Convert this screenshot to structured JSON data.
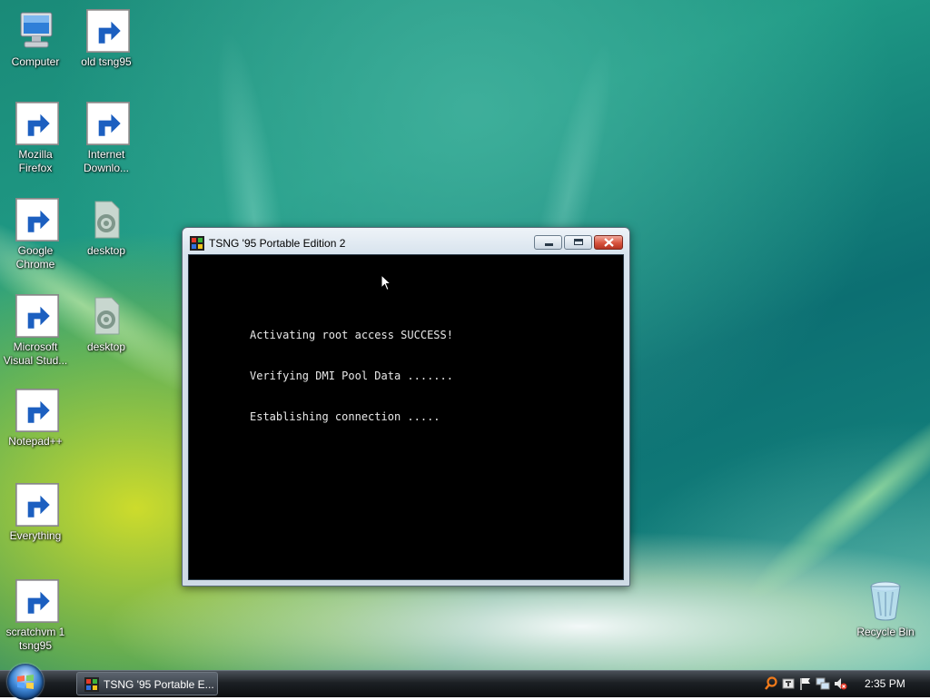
{
  "desktop_icons": [
    {
      "label": "Computer"
    },
    {
      "label": "old tsng95"
    },
    {
      "label": "Mozilla\nFirefox"
    },
    {
      "label": "Internet\nDownlo..."
    },
    {
      "label": "Google\nChrome"
    },
    {
      "label": "desktop"
    },
    {
      "label": "Microsoft\nVisual Stud..."
    },
    {
      "label": "desktop"
    },
    {
      "label": "Notepad++"
    },
    {
      "label": "Everything"
    },
    {
      "label": "scratchvm 1\ntsng95"
    },
    {
      "label": "Recycle Bin"
    }
  ],
  "window": {
    "title": "TSNG '95 Portable Edition 2",
    "console_lines": [
      "Activating root access SUCCESS!",
      "Verifying DMI Pool Data .......",
      "Establishing connection ....."
    ]
  },
  "taskbar": {
    "task_label": "TSNG '95 Portable E...",
    "clock": "2:35 PM"
  },
  "colors": {
    "console_bg": "#000000",
    "console_text": "#e8e8e8",
    "close_button": "#d8543e",
    "taskbar": "#1c2024"
  }
}
